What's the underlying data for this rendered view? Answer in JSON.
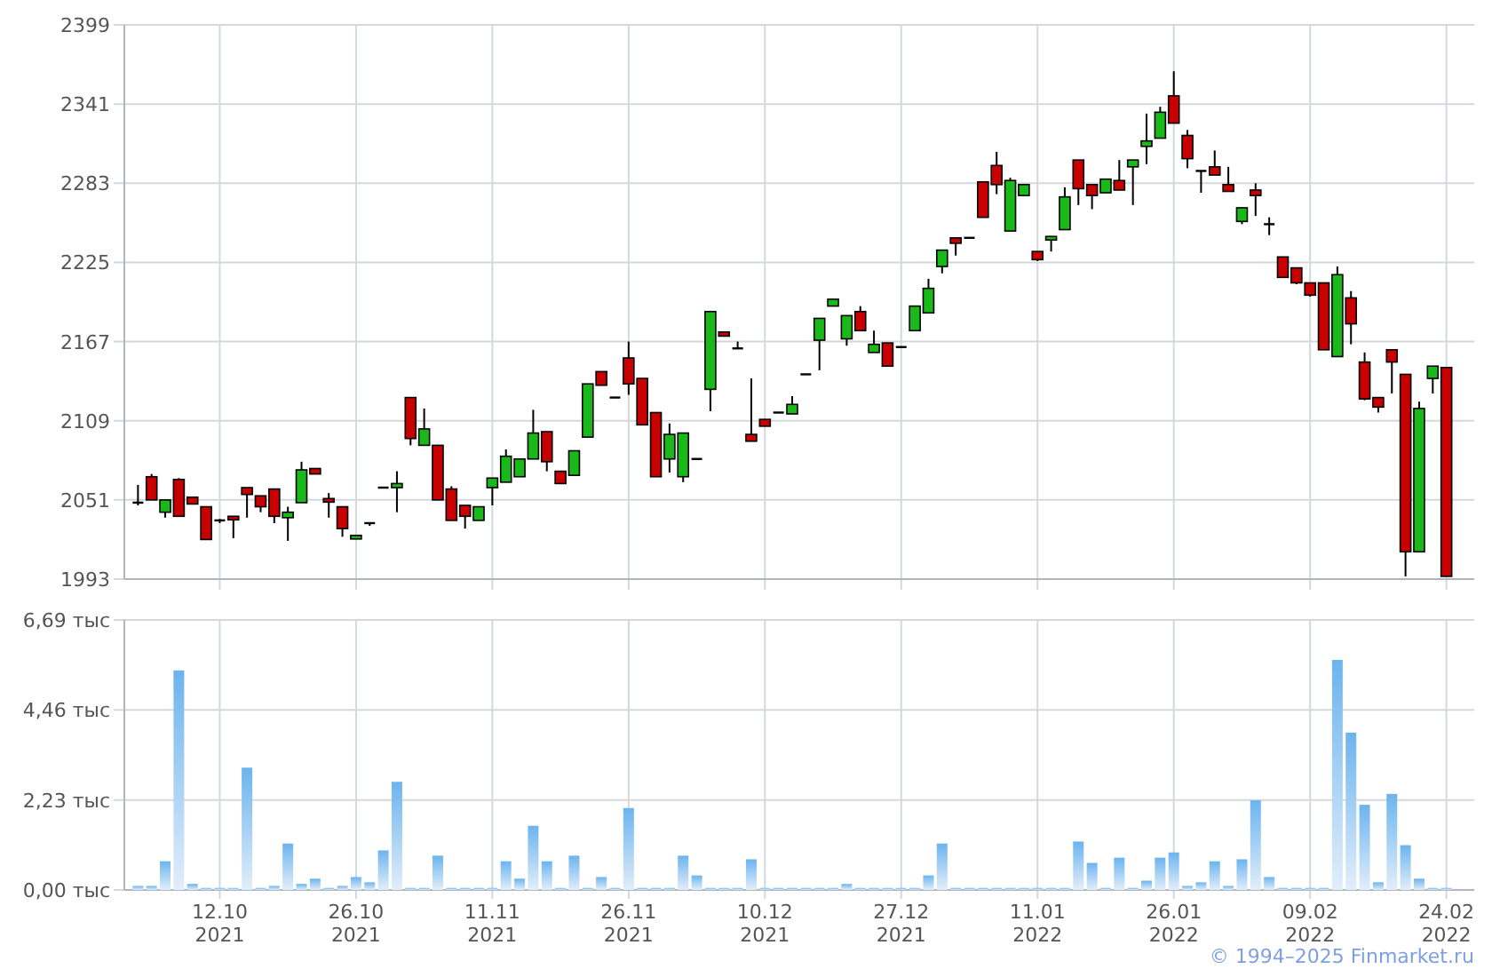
{
  "price_chart": {
    "chart_data": {
      "type": "candlestick",
      "grid": true,
      "ylim": [
        1993,
        2399
      ],
      "yticks": [
        1993,
        2051,
        2109,
        2167,
        2225,
        2283,
        2341,
        2399
      ],
      "categories": [
        null,
        null,
        null,
        null,
        null,
        null,
        null,
        null,
        null,
        null,
        null,
        null,
        null,
        null,
        null,
        null,
        null,
        null,
        null,
        null,
        null,
        null,
        null,
        null,
        null,
        null,
        null,
        null,
        null,
        null,
        null,
        null,
        null,
        null,
        null,
        null,
        null,
        null,
        null,
        null,
        null,
        null,
        null,
        null,
        null,
        null,
        null,
        null,
        null,
        null,
        null,
        null,
        null,
        null,
        null,
        null,
        null,
        null,
        null,
        null,
        null,
        null,
        null,
        null,
        null,
        null,
        null,
        null,
        null,
        null,
        null,
        null,
        null,
        null,
        null,
        null,
        null,
        null,
        null,
        null,
        null,
        null,
        null,
        null,
        null,
        null,
        null,
        null,
        null,
        null,
        null,
        null,
        null,
        null,
        null,
        null,
        null
      ],
      "ohlc": [
        [
          2049,
          2062,
          2047,
          2049
        ],
        [
          2068,
          2070,
          2051,
          2051
        ],
        [
          2042,
          2051,
          2038,
          2051
        ],
        [
          2066,
          2067,
          2039,
          2039
        ],
        [
          2053,
          2053,
          2048,
          2048
        ],
        [
          2046,
          2046,
          2022,
          2022
        ],
        [
          2036,
          2037,
          2034,
          2036
        ],
        [
          2039,
          2039,
          2023,
          2038
        ],
        [
          2060,
          2060,
          2038,
          2055
        ],
        [
          2054,
          2054,
          2042,
          2046
        ],
        [
          2059,
          2059,
          2034,
          2039
        ],
        [
          2038,
          2046,
          2021,
          2042
        ],
        [
          2049,
          2079,
          2049,
          2073
        ],
        [
          2074,
          2074,
          2070,
          2070
        ],
        [
          2052,
          2056,
          2038,
          2051
        ],
        [
          2046,
          2046,
          2024,
          2030
        ],
        [
          2023,
          2025,
          2023,
          2025
        ],
        [
          2034,
          2034,
          2032,
          2034
        ],
        [
          2060,
          2060,
          2060,
          2060
        ],
        [
          2060,
          2072,
          2042,
          2063
        ],
        [
          2126,
          2126,
          2091,
          2096
        ],
        [
          2091,
          2118,
          2091,
          2103
        ],
        [
          2091,
          2091,
          2051,
          2051
        ],
        [
          2059,
          2061,
          2036,
          2036
        ],
        [
          2047,
          2047,
          2030,
          2039
        ],
        [
          2036,
          2046,
          2036,
          2046
        ],
        [
          2060,
          2067,
          2047,
          2067
        ],
        [
          2064,
          2088,
          2064,
          2083
        ],
        [
          2068,
          2081,
          2068,
          2081
        ],
        [
          2081,
          2117,
          2081,
          2100
        ],
        [
          2101,
          2101,
          2072,
          2079
        ],
        [
          2072,
          2072,
          2063,
          2063
        ],
        [
          2069,
          2087,
          2069,
          2087
        ],
        [
          2097,
          2136,
          2097,
          2136
        ],
        [
          2145,
          2145,
          2135,
          2135
        ],
        [
          2126,
          2126,
          2126,
          2126
        ],
        [
          2155,
          2167,
          2128,
          2136
        ],
        [
          2140,
          2140,
          2106,
          2106
        ],
        [
          2115,
          2115,
          2068,
          2068
        ],
        [
          2081,
          2107,
          2071,
          2099
        ],
        [
          2068,
          2100,
          2064,
          2100
        ],
        [
          2081,
          2081,
          2081,
          2081
        ],
        [
          2132,
          2189,
          2116,
          2189
        ],
        [
          2174,
          2174,
          2171,
          2171
        ],
        [
          2162,
          2167,
          2162,
          2162
        ],
        [
          2099,
          2140,
          2094,
          2094
        ],
        [
          2110,
          2110,
          2105,
          2105
        ],
        [
          2115,
          2115,
          2115,
          2115
        ],
        [
          2114,
          2127,
          2114,
          2121
        ],
        [
          2143,
          2143,
          2143,
          2143
        ],
        [
          2168,
          2184,
          2146,
          2184
        ],
        [
          2193,
          2198,
          2193,
          2198
        ],
        [
          2169,
          2186,
          2164,
          2186
        ],
        [
          2189,
          2193,
          2175,
          2175
        ],
        [
          2159,
          2175,
          2159,
          2165
        ],
        [
          2166,
          2166,
          2149,
          2149
        ],
        [
          2163,
          2163,
          2163,
          2163
        ],
        [
          2175,
          2193,
          2175,
          2193
        ],
        [
          2188,
          2213,
          2188,
          2206
        ],
        [
          2222,
          2234,
          2217,
          2234
        ],
        [
          2243,
          2243,
          2230,
          2239
        ],
        [
          2243,
          2243,
          2243,
          2243
        ],
        [
          2284,
          2284,
          2258,
          2258
        ],
        [
          2296,
          2306,
          2275,
          2282
        ],
        [
          2248,
          2287,
          2248,
          2285
        ],
        [
          2274,
          2282,
          2274,
          2282
        ],
        [
          2233,
          2233,
          2226,
          2227
        ],
        [
          2242,
          2244,
          2233,
          2244
        ],
        [
          2249,
          2280,
          2249,
          2273
        ],
        [
          2300,
          2300,
          2267,
          2279
        ],
        [
          2282,
          2282,
          2264,
          2274
        ],
        [
          2276,
          2286,
          2276,
          2286
        ],
        [
          2285,
          2300,
          2278,
          2278
        ],
        [
          2295,
          2300,
          2267,
          2300
        ],
        [
          2310,
          2334,
          2297,
          2314
        ],
        [
          2316,
          2339,
          2316,
          2335
        ],
        [
          2347,
          2365,
          2327,
          2327
        ],
        [
          2318,
          2322,
          2294,
          2301
        ],
        [
          2292,
          2292,
          2276,
          2292
        ],
        [
          2295,
          2307,
          2289,
          2289
        ],
        [
          2282,
          2295,
          2277,
          2277
        ],
        [
          2255,
          2265,
          2253,
          2265
        ],
        [
          2278,
          2283,
          2259,
          2274
        ],
        [
          2253,
          2258,
          2245,
          2253
        ],
        [
          2229,
          2229,
          2214,
          2214
        ],
        [
          2221,
          2221,
          2209,
          2210
        ],
        [
          2210,
          2210,
          2200,
          2201
        ],
        [
          2210,
          2210,
          2161,
          2161
        ],
        [
          2156,
          2222,
          2156,
          2216
        ],
        [
          2199,
          2204,
          2165,
          2180
        ],
        [
          2152,
          2159,
          2124,
          2125
        ],
        [
          2126,
          2126,
          2115,
          2119
        ],
        [
          2161,
          2161,
          2129,
          2152
        ],
        [
          2143,
          2143,
          1995,
          2013
        ],
        [
          2013,
          2123,
          2013,
          2118
        ],
        [
          2140,
          2149,
          2129,
          2149
        ],
        [
          2148,
          2148,
          1995,
          1995
        ]
      ]
    }
  },
  "volume_chart": {
    "chart_data": {
      "type": "bar",
      "grid": true,
      "ylim": [
        0,
        6.69
      ],
      "yticks": [
        {
          "value": 0,
          "label": "0,00 тыс"
        },
        {
          "value": 2.23,
          "label": "2,23 тыс"
        },
        {
          "value": 4.46,
          "label": "4,46 тыс"
        },
        {
          "value": 6.69,
          "label": "6,69 тыс"
        }
      ],
      "categories": [
        null,
        null,
        null,
        null,
        null,
        null,
        "12.10\n2021",
        null,
        null,
        null,
        null,
        null,
        null,
        null,
        null,
        null,
        "26.10\n2021",
        null,
        null,
        null,
        null,
        null,
        null,
        null,
        null,
        null,
        "11.11\n2021",
        null,
        null,
        null,
        null,
        null,
        null,
        null,
        null,
        null,
        "26.11\n2021",
        null,
        null,
        null,
        null,
        null,
        null,
        null,
        null,
        null,
        "10.12\n2021",
        null,
        null,
        null,
        null,
        null,
        null,
        null,
        null,
        null,
        "27.12\n2021",
        null,
        null,
        null,
        null,
        null,
        null,
        null,
        null,
        null,
        "11.01\n2022",
        null,
        null,
        null,
        null,
        null,
        null,
        null,
        null,
        null,
        "26.01\n2022",
        null,
        null,
        null,
        null,
        null,
        null,
        null,
        null,
        null,
        "09.02\n2022",
        null,
        null,
        null,
        null,
        null,
        null,
        null,
        null,
        null,
        "24.02\n2022"
      ],
      "values": [
        0.1,
        0.1,
        0.71,
        5.44,
        0.15,
        0.05,
        0.05,
        0.05,
        3.03,
        0.05,
        0.1,
        1.15,
        0.15,
        0.28,
        0.05,
        0.1,
        0.32,
        0.19,
        0.98,
        2.68,
        0.05,
        0.05,
        0.85,
        0.05,
        0.05,
        0.05,
        0.05,
        0.71,
        0.28,
        1.59,
        0.71,
        0.05,
        0.85,
        0.05,
        0.32,
        0.05,
        2.03,
        0.05,
        0.05,
        0.05,
        0.85,
        0.36,
        0.05,
        0.05,
        0.05,
        0.76,
        0.05,
        0.05,
        0.05,
        0.05,
        0.05,
        0.05,
        0.15,
        0.05,
        0.05,
        0.05,
        0.05,
        0.05,
        0.36,
        1.15,
        0.05,
        0.05,
        0.05,
        0.05,
        0.05,
        0.05,
        0.05,
        0.05,
        0.05,
        1.2,
        0.67,
        0.05,
        0.8,
        0.05,
        0.23,
        0.8,
        0.93,
        0.1,
        0.19,
        0.71,
        0.1,
        0.76,
        2.22,
        0.32,
        0.05,
        0.05,
        0.05,
        0.05,
        5.7,
        3.9,
        2.11,
        0.19,
        2.38,
        1.11,
        0.28,
        0.05,
        0.05
      ]
    }
  },
  "footer": {
    "copyright": "© 1994–2025 Finmarket.ru"
  }
}
